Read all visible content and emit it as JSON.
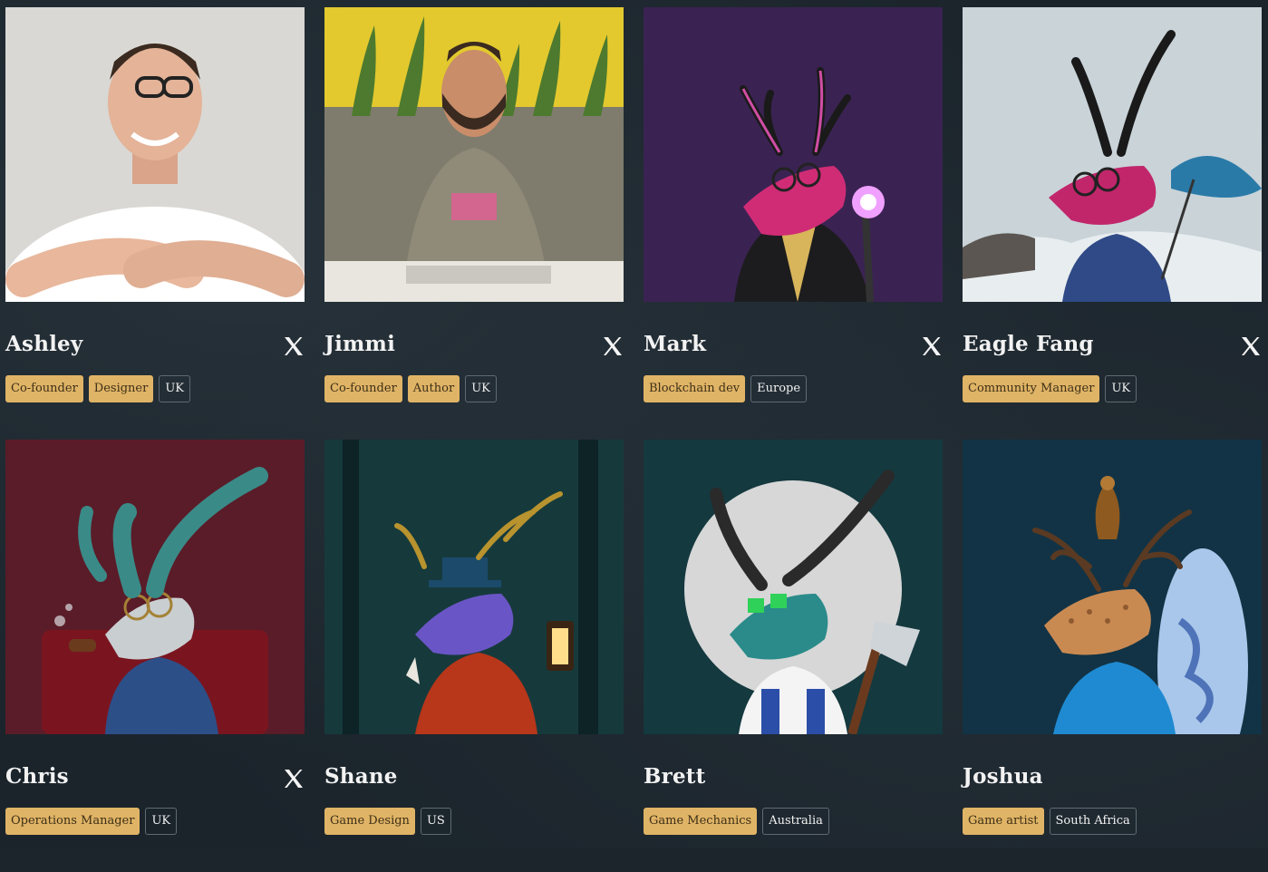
{
  "team": [
    {
      "name": "Ashley",
      "has_x_link": true,
      "roles": [
        "Co-founder",
        "Designer"
      ],
      "location": "UK",
      "portrait": "photo-man-glasses-white-tshirt",
      "portrait_colors": {
        "bg": "#d9d8d4",
        "accent": "#ffffff"
      }
    },
    {
      "name": "Jimmi",
      "has_x_link": true,
      "roles": [
        "Co-founder",
        "Author"
      ],
      "location": "UK",
      "portrait": "photo-man-desk-yellow-wall",
      "portrait_colors": {
        "bg": "#e3c92e",
        "accent": "#7f7c6e"
      }
    },
    {
      "name": "Mark",
      "has_x_link": true,
      "roles": [
        "Blockchain dev"
      ],
      "location": "Europe",
      "portrait": "illustration-deer-wizard-purple",
      "portrait_colors": {
        "bg": "#3a2352",
        "accent": "#d02c76"
      }
    },
    {
      "name": "Eagle Fang",
      "has_x_link": true,
      "roles": [
        "Community Manager"
      ],
      "location": "UK",
      "portrait": "illustration-antelope-umbrella-snow",
      "portrait_colors": {
        "bg": "#c9d3d8",
        "accent": "#c1266b"
      }
    },
    {
      "name": "Chris",
      "has_x_link": true,
      "roles": [
        "Operations Manager"
      ],
      "location": "UK",
      "portrait": "illustration-ibex-pipe-red",
      "portrait_colors": {
        "bg": "#5a1c28",
        "accent": "#3a8a88"
      }
    },
    {
      "name": "Shane",
      "has_x_link": false,
      "roles": [
        "Game Design"
      ],
      "location": "US",
      "portrait": "illustration-deer-tophat-lantern",
      "portrait_colors": {
        "bg": "#163a3c",
        "accent": "#6a55c6"
      }
    },
    {
      "name": "Brett",
      "has_x_link": false,
      "roles": [
        "Game Mechanics"
      ],
      "location": "Australia",
      "portrait": "illustration-antelope-axe-moon",
      "portrait_colors": {
        "bg": "#14393f",
        "accent": "#2a8b8a"
      }
    },
    {
      "name": "Joshua",
      "has_x_link": false,
      "roles": [
        "Game artist"
      ],
      "location": "South Africa",
      "portrait": "illustration-deer-eagle-surfboard",
      "portrait_colors": {
        "bg": "#123345",
        "accent": "#c98a52"
      }
    }
  ]
}
